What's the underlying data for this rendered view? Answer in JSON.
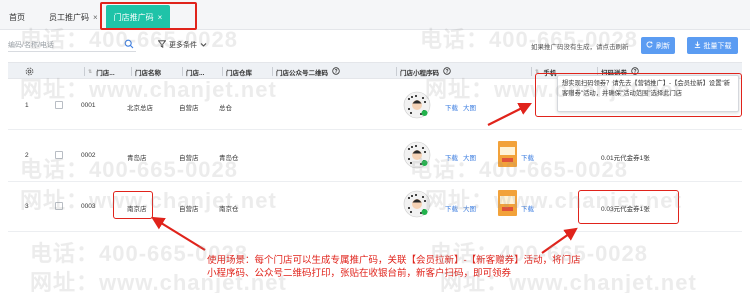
{
  "tabs": {
    "home": "首页",
    "employee": "员工推广码",
    "store": "门店推广码",
    "close": "×"
  },
  "toolbar": {
    "search_placeholder": "编码/名称/电话",
    "more_filters": "更多条件",
    "tip": "如果推广码没有生成，请点击刷新",
    "refresh": "刷新",
    "bulk_download": "批量下载"
  },
  "table": {
    "headers": {
      "no": "门店...",
      "name": "门店名称",
      "type": "门店...",
      "warehouse": "门店仓库",
      "wechat_qr": "门店公众号二维码",
      "mini_qr": "门店小程序码",
      "phone": "手机",
      "coupon": "扫码送券"
    },
    "download": "下载",
    "large": "大图",
    "rows": [
      {
        "idx": "1",
        "no": "0001",
        "name": "北京总店",
        "type": "自营店",
        "warehouse": "总仓",
        "coupon": ""
      },
      {
        "idx": "2",
        "no": "0002",
        "name": "青岛店",
        "type": "自营店",
        "warehouse": "青岛仓",
        "coupon": "0.01元代金券1张"
      },
      {
        "idx": "3",
        "no": "0003",
        "name": "南京店",
        "type": "自营店",
        "warehouse": "南京仓",
        "coupon": "0.03元代金券1张"
      }
    ]
  },
  "tooltip": "想实现扫码领券？请先去【营销推广】-【会员拉新】设置\"新客赠券\"活动，并确保\"活动范围\"选择此门店",
  "note": "使用场景：每个门店可以生成专属推广码，关联【会员拉新】-【新客赠券】活动，将门店小程序码、公众号二维码打印，张贴在收银台前，新客户扫码，即可领券",
  "watermark": {
    "phone": "电话：400-665-0028",
    "site": "网址：www.chanjet.net"
  },
  "colors": {
    "accent": "#1fc3a8",
    "button": "#5b9cf2",
    "annotation": "#e0231b",
    "link": "#3a7ce0"
  }
}
